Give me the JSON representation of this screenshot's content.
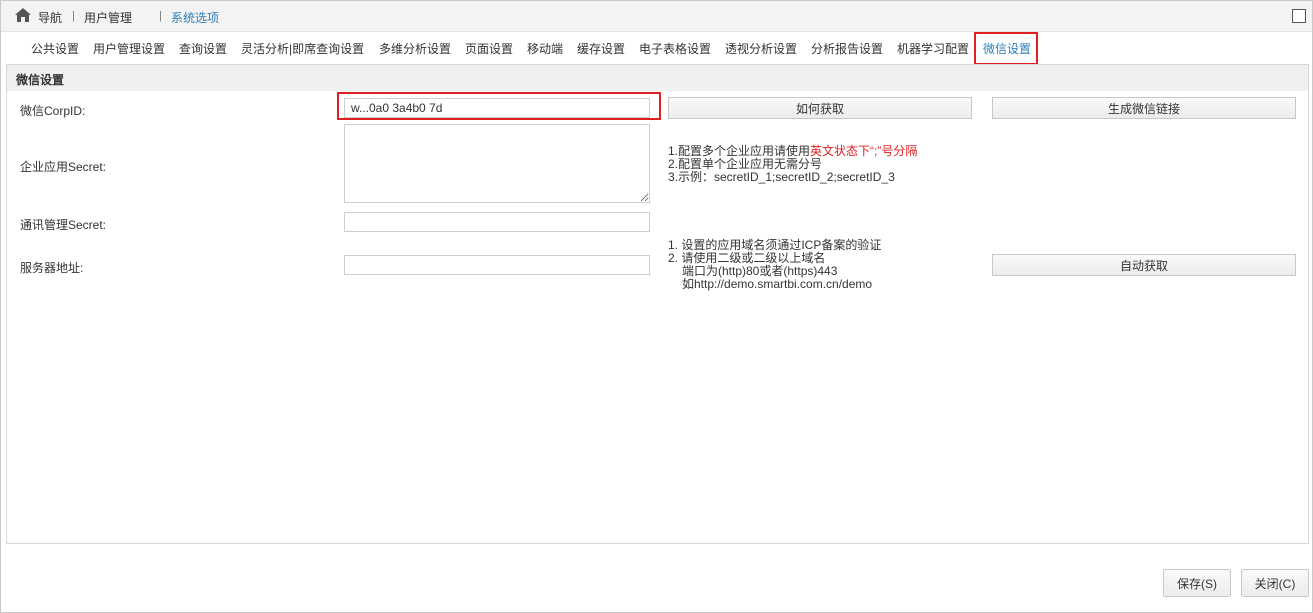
{
  "breadcrumb": {
    "home": "导航",
    "user_mgmt": "用户管理",
    "current": "系统选项"
  },
  "tabs": [
    {
      "label": "公共设置"
    },
    {
      "label": "用户管理设置"
    },
    {
      "label": "查询设置"
    },
    {
      "label": "灵活分析|即席查询设置"
    },
    {
      "label": "多维分析设置"
    },
    {
      "label": "页面设置"
    },
    {
      "label": "移动端"
    },
    {
      "label": "缓存设置"
    },
    {
      "label": "电子表格设置"
    },
    {
      "label": "透视分析设置"
    },
    {
      "label": "分析报告设置"
    },
    {
      "label": "机器学习配置"
    },
    {
      "label": "微信设置"
    }
  ],
  "active_tab": "微信设置",
  "panel": {
    "title": "微信设置",
    "corpid": {
      "label": "微信CorpID:",
      "value": "w...0a0 3a4b0 7d",
      "how_button": "如何获取",
      "gen_button": "生成微信链接"
    },
    "app_secret": {
      "label": "企业应用Secret:",
      "value": "",
      "hint_line1_prefix": "1.配置多个企业应用请使用",
      "hint_line1_red": "英文状态下“;”号分隔",
      "hint_line2": "2.配置单个企业应用无需分号",
      "hint_line3": "3.示例：secretID_1;secretID_2;secretID_3"
    },
    "contact_secret": {
      "label": "通讯管理Secret:",
      "value": ""
    },
    "server": {
      "label": "服务器地址:",
      "value": "",
      "hint_line1": "1. 设置的应用域名须通过ICP备案的验证",
      "hint_line2": "2. 请使用二级或二级以上域名",
      "hint_line3": "端口为(http)80或者(https)443",
      "hint_line4": "如http://demo.smartbi.com.cn/demo",
      "auto_button": "自动获取"
    }
  },
  "footer": {
    "save": "保存(S)",
    "close": "关闭(C)"
  },
  "colors": {
    "accent": "#2c7fb8",
    "highlight": "#e02020"
  }
}
